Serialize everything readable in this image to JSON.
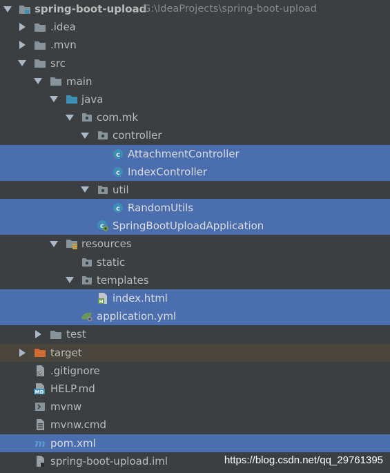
{
  "project": {
    "name": "spring-boot-upload",
    "path": "G:\\IdeaProjects\\spring-boot-upload"
  },
  "colors": {
    "background": "#3c3f41",
    "selection": "#4b6eaf",
    "excluded": "#49443c",
    "folder": "#87939a",
    "source_folder": "#3d8fb5",
    "excluded_folder": "#d06c31",
    "class_icon": "#3d8fb5"
  },
  "tree": [
    {
      "label": ".idea",
      "icon": "folder-icon"
    },
    {
      "label": ".mvn",
      "icon": "folder-icon"
    },
    {
      "label": "src",
      "icon": "folder-icon"
    },
    {
      "label": "main",
      "icon": "folder-icon"
    },
    {
      "label": "java",
      "icon": "source-folder-icon"
    },
    {
      "label": "com.mk",
      "icon": "package-icon"
    },
    {
      "label": "controller",
      "icon": "package-icon"
    },
    {
      "label": "AttachmentController",
      "icon": "java-class-icon"
    },
    {
      "label": "IndexController",
      "icon": "java-class-icon"
    },
    {
      "label": "util",
      "icon": "package-icon"
    },
    {
      "label": "RandomUtils",
      "icon": "java-class-icon"
    },
    {
      "label": "SpringBootUploadApplication",
      "icon": "spring-boot-class-icon"
    },
    {
      "label": "resources",
      "icon": "resources-folder-icon"
    },
    {
      "label": "static",
      "icon": "package-icon"
    },
    {
      "label": "templates",
      "icon": "package-icon"
    },
    {
      "label": "index.html",
      "icon": "html-file-icon"
    },
    {
      "label": "application.yml",
      "icon": "yaml-config-icon"
    },
    {
      "label": "test",
      "icon": "folder-icon"
    },
    {
      "label": "target",
      "icon": "excluded-folder-icon"
    },
    {
      "label": ".gitignore",
      "icon": "gitignore-file-icon"
    },
    {
      "label": "HELP.md",
      "icon": "markdown-file-icon"
    },
    {
      "label": "mvnw",
      "icon": "shell-script-icon"
    },
    {
      "label": "mvnw.cmd",
      "icon": "text-file-icon"
    },
    {
      "label": "pom.xml",
      "icon": "maven-file-icon"
    },
    {
      "label": "spring-boot-upload.iml",
      "icon": "iml-file-icon"
    }
  ],
  "watermark": "https://blog.csdn.net/qq_29761395"
}
